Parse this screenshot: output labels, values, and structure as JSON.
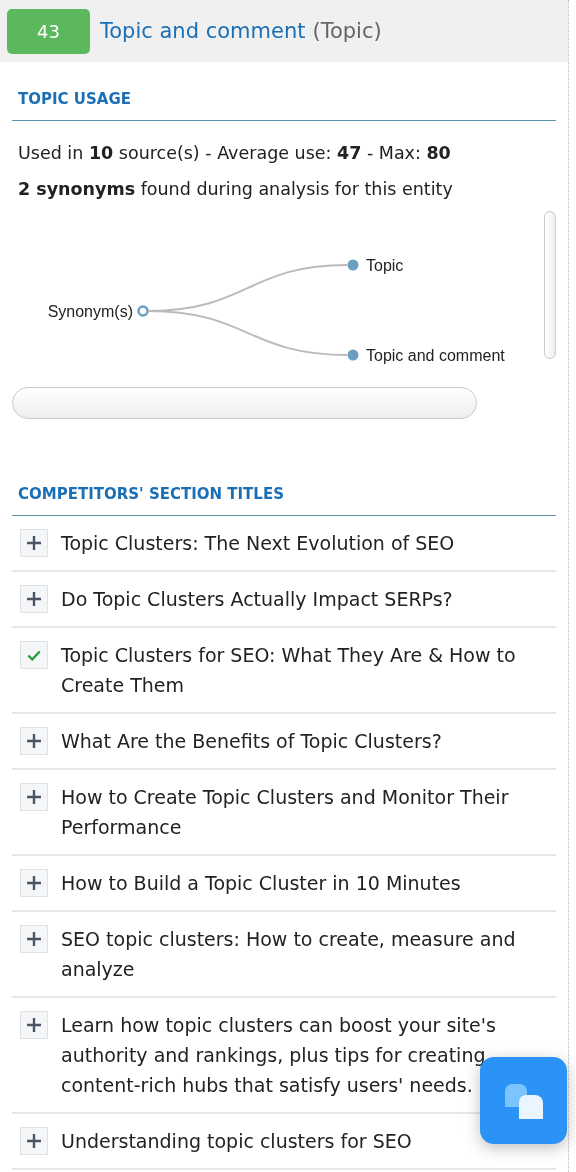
{
  "header": {
    "score": "43",
    "title": "Topic and comment",
    "type": "(Topic)"
  },
  "usage": {
    "heading": "TOPIC USAGE",
    "stats": "Used in **10** source(s) - Average use: **47** - Max: **80**",
    "synonyms": "**2 synonyms** found during analysis for this entity",
    "tree": {
      "label": "Synonym(s)",
      "children": [
        {
          "label": "Topic"
        },
        {
          "label": "Topic and comment"
        }
      ]
    }
  },
  "sections": {
    "heading": "COMPETITORS' SECTION TITLES",
    "items": [
      {
        "title": "Topic Clusters: The Next Evolution of SEO",
        "added": false
      },
      {
        "title": "Do Topic Clusters Actually Impact SERPs?",
        "added": false
      },
      {
        "title": "Topic Clusters for SEO: What They Are & How to Create Them",
        "added": true
      },
      {
        "title": "What Are the Benefits of Topic Clusters?",
        "added": false
      },
      {
        "title": "How to Create Topic Clusters and Monitor Their Performance",
        "added": false
      },
      {
        "title": "How to Build a Topic Cluster in 10 Minutes",
        "added": false
      },
      {
        "title": "SEO topic clusters: How to create, measure and analyze",
        "added": false
      },
      {
        "title": "Learn how topic clusters can boost your site's authority and rankings, plus tips for creating content-rich hubs that satisfy users' needs.",
        "added": false
      },
      {
        "title": "Understanding topic clusters for SEO",
        "added": false
      }
    ]
  }
}
